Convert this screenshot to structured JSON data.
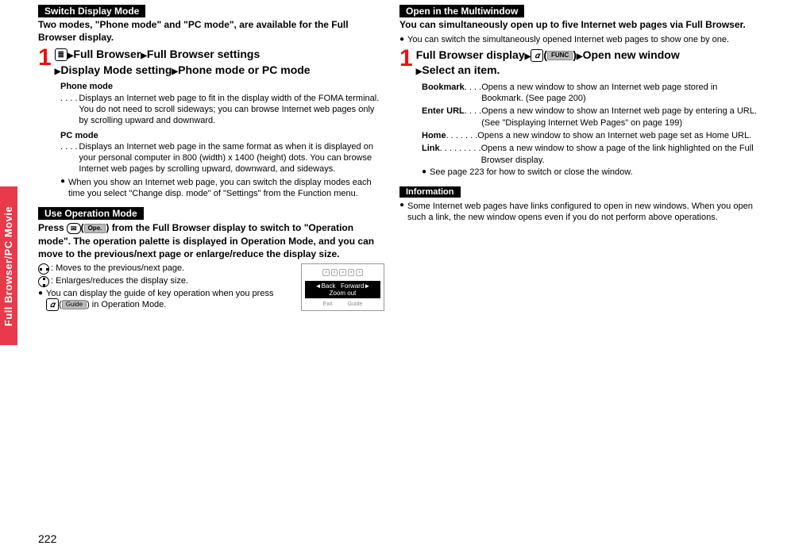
{
  "sidebar_tab": "Full Browser/PC Movie",
  "page_number": "222",
  "left": {
    "switch_heading": "Switch Display Mode",
    "switch_intro": "Two modes, \"Phone mode\" and \"PC mode\", are available for the Full Browser display.",
    "step_num": "1",
    "nav1a": "Full Browser",
    "nav1b": "Full Browser settings",
    "nav2a": "Display Mode setting",
    "nav2b": "Phone mode or PC mode",
    "phone_mode_label": "Phone mode",
    "phone_mode_dots": " . . . .",
    "phone_mode_desc": "Displays an Internet web page to fit in the display width of the FOMA terminal. You do not need to scroll sideways; you can browse Internet web pages only by scrolling upward and downward.",
    "pc_mode_label": "PC mode",
    "pc_mode_dots": " . . . .",
    "pc_mode_desc": "Displays an Internet web page in the same format as when it is displayed on your personal computer in 800 (width) x 1400 (height) dots. You can browse Internet web pages by scrolling upward, downward, and sideways.",
    "switch_bullet": "When you show an Internet web page, you can switch the display modes each time you select \"Change disp. mode\" of \"Settings\" from the Function menu.",
    "use_heading": "Use Operation Mode",
    "use_intro_a": "Press ",
    "use_intro_b": "(",
    "use_intro_ope": "Ope.",
    "use_intro_c": ") from the Full Browser display to switch to \"Operation mode\". The operation palette is displayed in Operation Mode, and you can move to the previous/next page or enlarge/reduce the display size.",
    "op_lr": ": Moves to the previous/next page.",
    "op_ud": ": Enlarges/reduces the display size.",
    "op_guide_a": "You can display the guide of key operation when you press ",
    "op_guide_b": "(",
    "op_guide_label": "Guide",
    "op_guide_c": ") in Operation Mode.",
    "guide_img": {
      "back": "◄Back",
      "forward": "Forward►",
      "zoom": "Zoom out",
      "exit": "Exit",
      "guide": "Guide"
    }
  },
  "right": {
    "open_heading": "Open in the Multiwindow",
    "open_intro": "You can simultaneously open up to five Internet web pages via Full Browser.",
    "open_bullet": "You can switch the simultaneously opened Internet web pages to show one by one.",
    "step_num": "1",
    "nav1a": "Full Browser display",
    "nav1_func": "FUNC",
    "nav1b": "Open new window",
    "nav2": "Select an item.",
    "defs": [
      {
        "term": "Bookmark",
        "dots": ". . . .",
        "def": "Opens a new window to show an Internet web page stored in Bookmark. (See page 200)"
      },
      {
        "term": "Enter URL",
        "dots": ". . . .",
        "def": "Opens a new window to show an Internet web page by entering a URL. (See \"Displaying Internet Web Pages\" on page 199)"
      },
      {
        "term": "Home",
        "dots": ". . . . . . .",
        "def": "Opens a new window to show an Internet web page set as Home URL."
      },
      {
        "term": "Link",
        "dots": " . . . . . . . . .",
        "def": "Opens a new window to show a page of the link highlighted on the Full Browser display."
      }
    ],
    "see_page": "See page 223 for how to switch or close the window.",
    "info_heading": "Information",
    "info_body": "Some Internet web pages have links configured to open in new windows. When you open such a link, the new window opens even if you do not perform above operations."
  }
}
